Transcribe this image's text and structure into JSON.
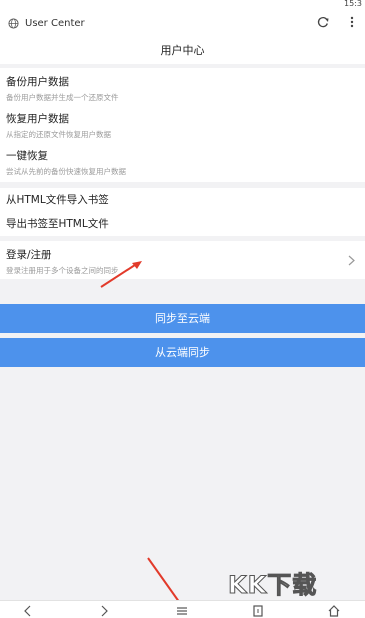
{
  "status_bar": {
    "time": "15:3"
  },
  "address_bar": {
    "url": "User Center"
  },
  "page": {
    "title": "用户中心"
  },
  "backup_section": {
    "items": [
      {
        "title": "备份用户数据",
        "subtitle": "备份用户数据并生成一个还原文件"
      },
      {
        "title": "恢复用户数据",
        "subtitle": "从指定的还原文件恢复用户数据"
      },
      {
        "title": "一键恢复",
        "subtitle": "尝试从先前的备份快速恢复用户数据"
      }
    ]
  },
  "bookmark_section": {
    "items": [
      {
        "title": "从HTML文件导入书签"
      },
      {
        "title": "导出书签至HTML文件"
      }
    ]
  },
  "account_section": {
    "title": "登录/注册",
    "subtitle": "登录注册用于多个设备之间的同步"
  },
  "buttons": {
    "sync_to_cloud": "同步至云端",
    "sync_from_cloud": "从云端同步"
  },
  "watermark": {
    "text": "KK下载"
  },
  "colors": {
    "accent": "#4d92ec",
    "annotation_arrow": "#e23a2a",
    "background": "#f2f2f4"
  },
  "icons": {
    "address_bar": [
      "globe-icon",
      "reload-icon",
      "more-vertical-icon"
    ],
    "bottom_nav": [
      "back-icon",
      "forward-icon",
      "menu-icon",
      "tabs-icon",
      "home-icon"
    ]
  }
}
